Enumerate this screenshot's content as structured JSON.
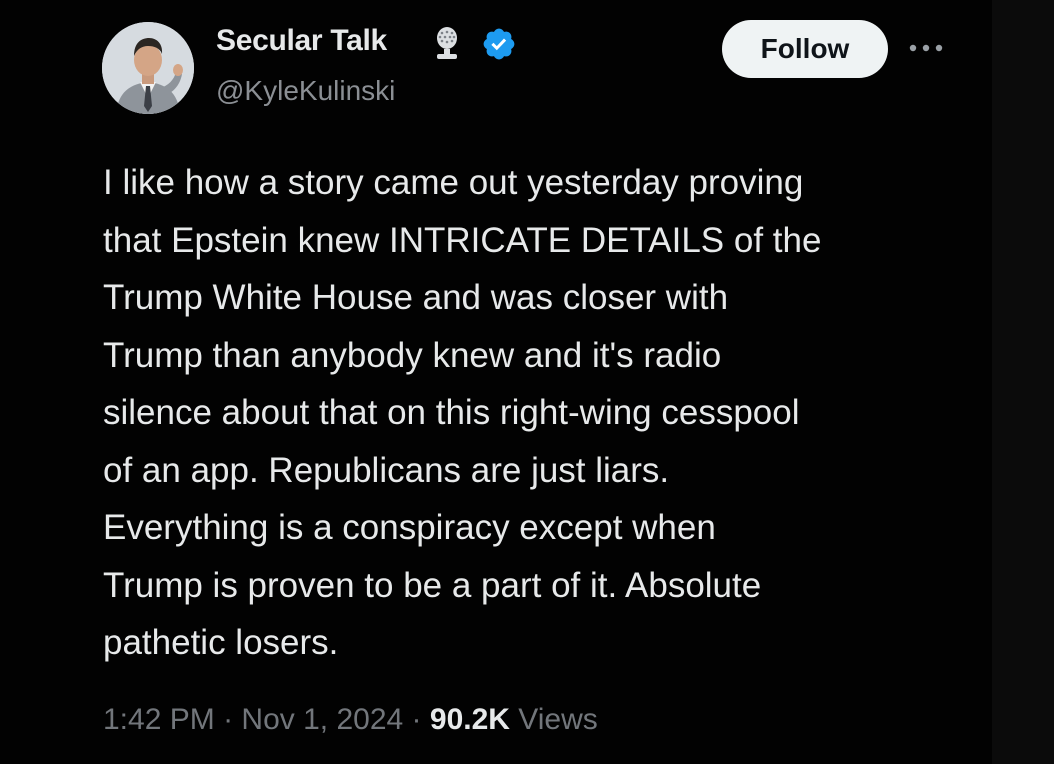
{
  "user": {
    "display_name": "Secular Talk",
    "handle": "@KyleKulinski",
    "avatar_icon": "profile-photo",
    "badge_icons": [
      "microphone-icon",
      "verified-icon"
    ],
    "verified_color": "#1d9bf0"
  },
  "actions": {
    "follow_label": "Follow",
    "more_icon": "more-horizontal-icon"
  },
  "tweet": {
    "lines": [
      "I like how a story came out yesterday proving",
      "that Epstein knew INTRICATE DETAILS of the",
      "Trump White House and was closer with",
      "Trump than anybody knew and it's radio",
      "silence about that on this right-wing cesspool",
      "of an app. Republicans are just liars.",
      "Everything is a conspiracy except when",
      "Trump is proven to be a part of it. Absolute",
      "pathetic losers."
    ]
  },
  "meta": {
    "time": "1:42 PM",
    "separator": "·",
    "date": "Nov 1, 2024",
    "views_count": "90.2K",
    "views_label": "Views"
  },
  "colors": {
    "background": "#020202",
    "text": "#e7e9ea",
    "secondary_text": "#8b8f94",
    "follow_bg": "#eff3f4"
  }
}
